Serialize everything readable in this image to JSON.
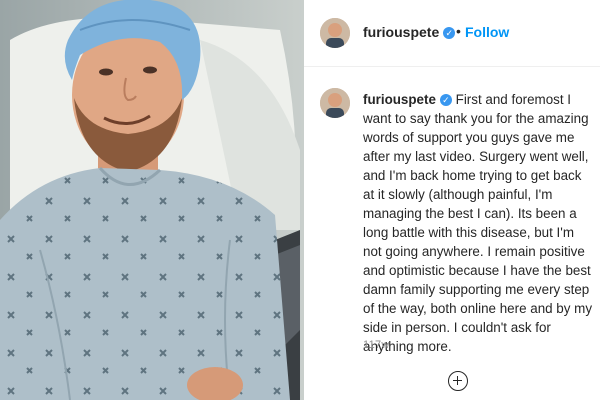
{
  "post": {
    "username": "furiouspete",
    "follow_label": "Follow",
    "separator": "•",
    "verified_icon": "verified-badge-icon",
    "caption": "First and foremost I want to say thank you for the amazing words of support you guys gave me after my last video. Surgery went well, and I'm back home trying to get back at it slowly (although painful, I'm managing the best I can). Its been a long battle with this disease, but I'm not going anywhere. I remain positive and optimistic because I have the best damn family supporting me every step of the way, both online here and by my side in person. I couldn't ask for anything more.",
    "timestamp": "117w",
    "photo_description": "photo",
    "add_comment_icon": "plus-circle-icon"
  },
  "colors": {
    "follow": "#0095f6",
    "verified": "#3897f0",
    "timestamp": "#8e8e8e",
    "text": "#262626"
  }
}
